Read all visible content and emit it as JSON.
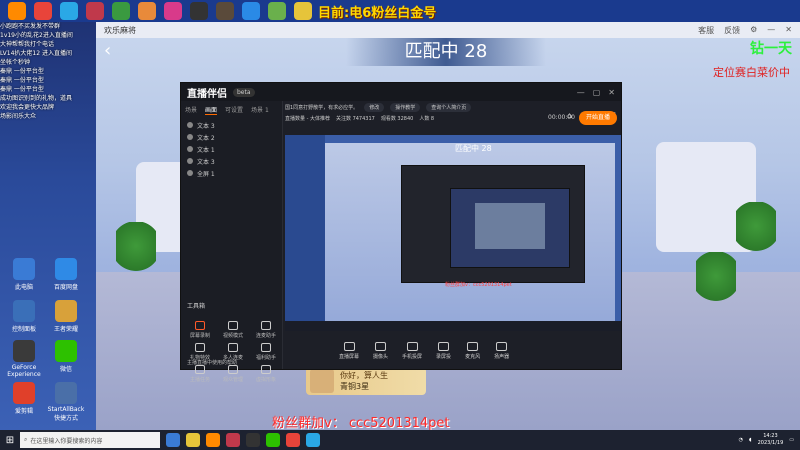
{
  "overlay": {
    "top_text": "目前:电6粉丝白金号",
    "fan_text": "粉丝群加v：  ccc5201314pet",
    "green_text": "钻一天",
    "rank_text": "定位赛白菜价中"
  },
  "desktop": {
    "chat_lines": [
      "小跑跑不买发发不带群",
      "1v19小的乱花2进入直播间",
      "大神帮帮我打个电话",
      "LV14扒大佬12 进入直播间",
      "坐帐个秒钟",
      "秦鼎 一份平台型",
      "秦鼎 一份平台型",
      "秦鼎 一份平台型",
      "成功图识别到的礼物，道具",
      "欢迎我会更快大品牌",
      "场影间乐大众"
    ],
    "icons": [
      {
        "label": "此电脑",
        "color": "#3a7bd5"
      },
      {
        "label": "百度网盘",
        "color": "#2f8ae6"
      },
      {
        "label": "控制面板",
        "color": "#3a6fb8"
      },
      {
        "label": "王者荣耀",
        "color": "#d8a13a"
      },
      {
        "label": "GeForce Experience",
        "color": "#3a3a3a"
      },
      {
        "label": "微信",
        "color": "#2dc100"
      },
      {
        "label": "爱剪辑",
        "color": "#e0402a"
      },
      {
        "label": "StartAllBack 快捷方式",
        "color": "#4a6fa8"
      }
    ]
  },
  "game_window": {
    "title": "欢乐麻将",
    "title_actions": [
      "客服",
      "反馈",
      "⚙",
      "—",
      "✕"
    ],
    "match_text": "匹配中 28",
    "player_name": "你好，算人生",
    "player_rank": "青铜3星"
  },
  "live_app": {
    "logo": "直播伴侣",
    "version": "beta",
    "window_controls": [
      "—",
      "▢",
      "✕"
    ],
    "scene_tabs": [
      "场景",
      "画面",
      "可设置",
      "场景 1"
    ],
    "sources": [
      "文本 3",
      "文本 2",
      "文本 1",
      "文本 3",
      "全屏 1"
    ],
    "tools_header": "工具箱",
    "tools": [
      {
        "label": "屏幕录制"
      },
      {
        "label": "视频模式"
      },
      {
        "label": "连麦助手"
      },
      {
        "label": "礼物特效"
      },
      {
        "label": "多人连麦"
      },
      {
        "label": "福利助手"
      },
      {
        "label": "主播任务"
      },
      {
        "label": "观众管理"
      },
      {
        "label": "虚拟形象"
      }
    ],
    "hint": "主播直播中使用的帮助",
    "info_title": "国1同意打野散学，有求必应学。",
    "info_pills": [
      "修改",
      "操作教学",
      "查询个人简介页"
    ],
    "stats": [
      "直播数量 - 大体推荐",
      "关注数 7474317",
      "观看数 32840",
      "人数 8"
    ],
    "bottom_items": [
      "直播屏幕",
      "摄像头",
      "手机投屏",
      "录屏投",
      "麦克风",
      "扬声器"
    ],
    "time": "00:00:00",
    "start_button": "开始直播",
    "preview_banner": "匹配中 28",
    "preview_red": "粉丝群加v：ccc5201314pet"
  },
  "taskbar": {
    "search_placeholder": "在这里输入你要搜索的内容",
    "time": "14:23",
    "date": "2023/1/19"
  }
}
